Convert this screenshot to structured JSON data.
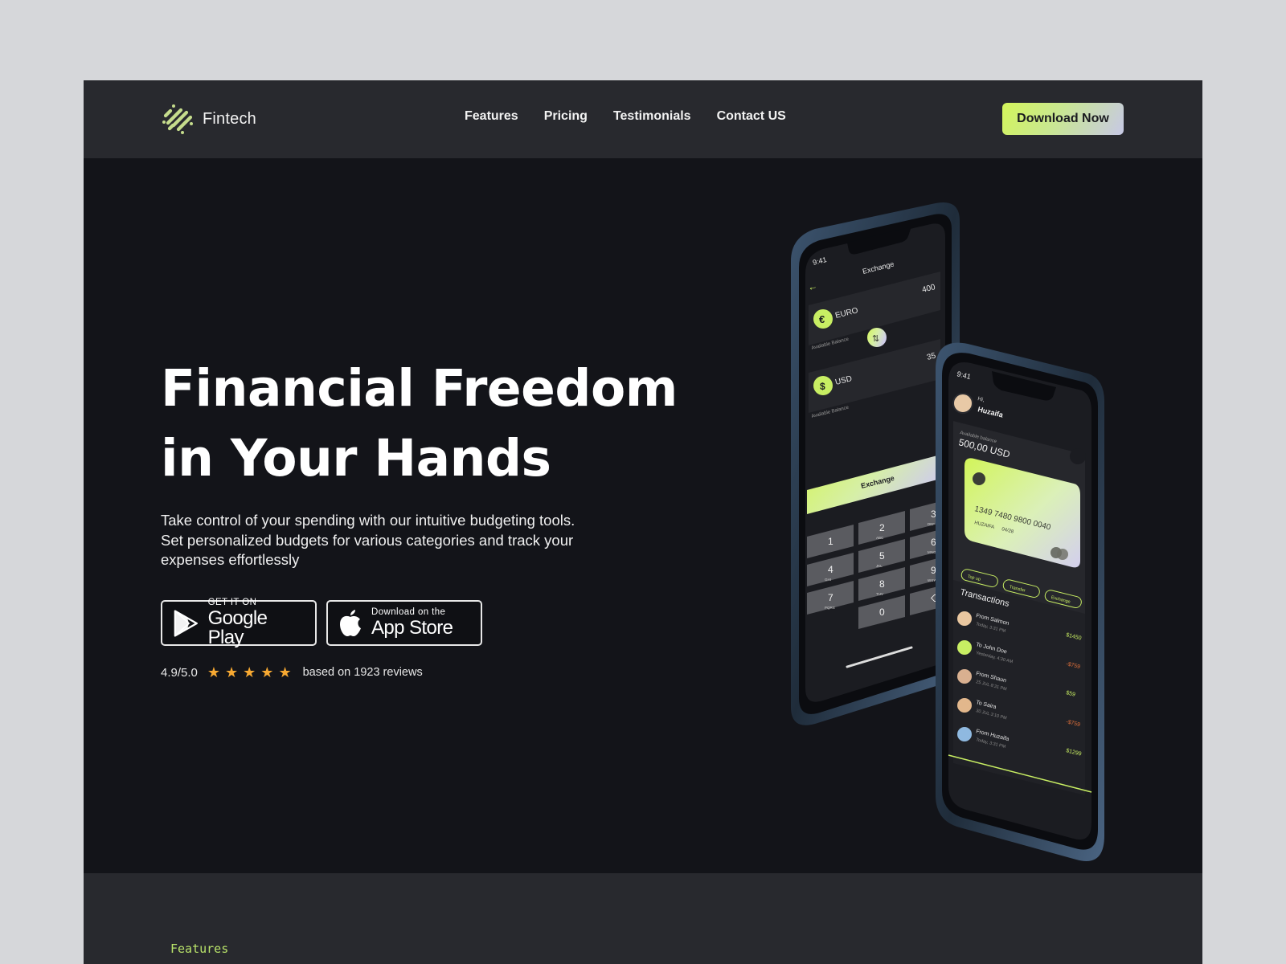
{
  "header": {
    "brand": "Fintech",
    "nav": [
      {
        "label": "Features"
      },
      {
        "label": "Pricing"
      },
      {
        "label": "Testimonials"
      },
      {
        "label": "Contact US"
      }
    ],
    "cta_label": "Download Now"
  },
  "hero": {
    "title_line1": "Financial Freedom",
    "title_line2": "in Your Hands",
    "description": "Take control of your spending with our intuitive budgeting tools. Set personalized budgets for various categories and track your expenses effortlessly",
    "stores": {
      "google_small": "GET IT ON",
      "google_big": "Google Play",
      "apple_small": "Download on the",
      "apple_big": "App Store"
    },
    "rating": {
      "score": "4.9/5.0",
      "stars": 5,
      "text": "based on 1923 reviews"
    }
  },
  "phone_exchange": {
    "time": "9:41",
    "title": "Exchange",
    "from_currency": "EURO",
    "from_symbol": "€",
    "from_amount": "400",
    "to_currency": "USD",
    "to_symbol": "$",
    "to_amount": "35",
    "balance_label": "Available Balance",
    "button": "Exchange",
    "keys": [
      {
        "num": "1",
        "sub": ""
      },
      {
        "num": "2",
        "sub": "ABC"
      },
      {
        "num": "3",
        "sub": "DEF"
      },
      {
        "num": "4",
        "sub": "GHI"
      },
      {
        "num": "5",
        "sub": "JKL"
      },
      {
        "num": "6",
        "sub": "MNO"
      },
      {
        "num": "7",
        "sub": "PQRS"
      },
      {
        "num": "8",
        "sub": "TUV"
      },
      {
        "num": "9",
        "sub": "WXYZ"
      },
      {
        "num": "",
        "sub": ""
      },
      {
        "num": "0",
        "sub": ""
      },
      {
        "num": "⌫",
        "sub": ""
      }
    ]
  },
  "phone_home": {
    "time": "9:41",
    "greeting": "Hi,",
    "user": "Huzaifa",
    "balance_label": "Available balance",
    "balance": "500,00 USD",
    "card_number": "1349 7480 9800 0040",
    "card_holder": "HUZAIFA",
    "card_expiry": "04/28",
    "actions": [
      "Top up",
      "Transfer",
      "Exchange"
    ],
    "transactions_title": "Transactions",
    "transactions": [
      {
        "name": "From Salmon",
        "time": "Today, 3:31 PM",
        "amount": "$1450",
        "type": "in"
      },
      {
        "name": "To John Doe",
        "time": "Yesterday, 4:30 AM",
        "amount": "-$759",
        "type": "out"
      },
      {
        "name": "From Shaun",
        "time": "25 JUL 8:31 PM",
        "amount": "$59",
        "type": "in"
      },
      {
        "name": "To Saira",
        "time": "30 JUL 3:10 PM",
        "amount": "-$759",
        "type": "out"
      },
      {
        "name": "From Huzaifa",
        "time": "Today, 3:31 PM",
        "amount": "$1299",
        "type": "in"
      }
    ]
  },
  "section2": {
    "label": "Features"
  },
  "colors": {
    "accent": "#c8ee63",
    "header_bg": "#28292e",
    "hero_bg": "#131419",
    "star": "#f7a932",
    "negative": "#e0703a"
  }
}
